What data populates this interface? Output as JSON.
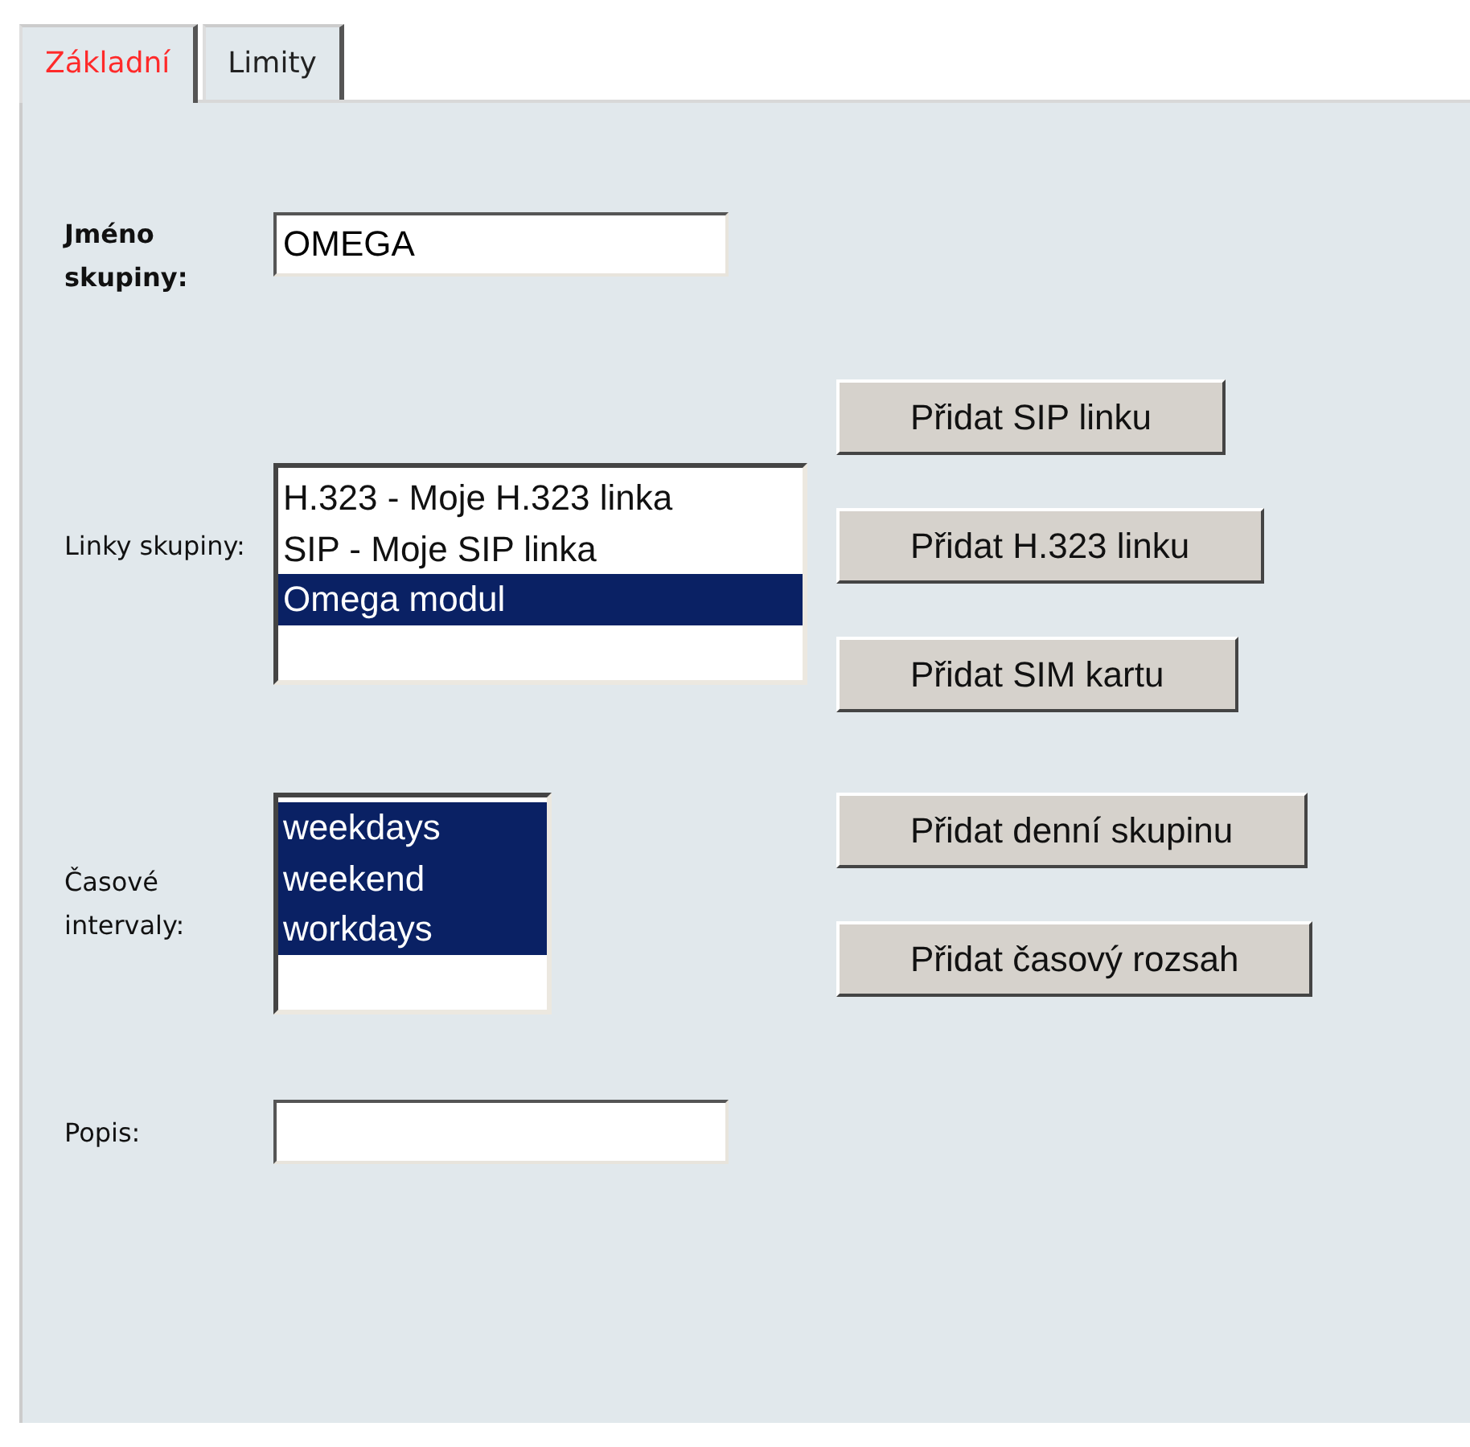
{
  "tabs": [
    {
      "label": "Základní",
      "selected": true
    },
    {
      "label": "Limity",
      "selected": false
    }
  ],
  "group_name": {
    "label": "Jméno skupiny:",
    "value": "OMEGA"
  },
  "lines": {
    "label": "Linky skupiny:",
    "items": [
      {
        "label": "H.323 - Moje H.323 linka",
        "selected": false
      },
      {
        "label": "SIP - Moje SIP linka",
        "selected": false
      },
      {
        "label": "Omega modul",
        "selected": true
      }
    ],
    "buttons": [
      "Přidat SIP linku",
      "Přidat H.323 linku",
      "Přidat SIM kartu"
    ]
  },
  "intervals": {
    "label": "Časové intervaly:",
    "items": [
      {
        "label": "weekdays",
        "selected": true
      },
      {
        "label": "weekend",
        "selected": true
      },
      {
        "label": "workdays",
        "selected": true
      }
    ],
    "buttons": [
      "Přidat denní skupinu",
      "Přidat časový rozsah"
    ]
  },
  "description": {
    "label": "Popis:"
  }
}
